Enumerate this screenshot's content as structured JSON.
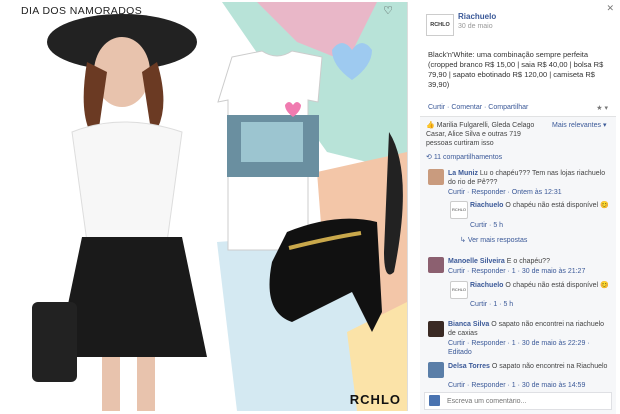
{
  "photo": {
    "title": "DIA DOS NAMORADOS",
    "brand": "RCHLO"
  },
  "post": {
    "page_name": "Riachuelo",
    "date": "30 de maio",
    "logo": "RCHLO",
    "caption": "Black'n'White: uma combinação sempre perfeita (cropped branco R$ 15,00 | saia R$ 40,00 | bolsa R$ 79,90 | sapato ebotinado R$ 120,00 | camiseta R$ 39,90)",
    "actions": "Curtir · Comentar · Compartilhar",
    "likes": "Marilia Fulgarelli, Gleda Celago Casar, Alice Silva e outras 719 pessoas curtiram isso",
    "sort": "Mais relevantes",
    "shares": "11 compartilhamentos"
  },
  "comments": [
    {
      "author": "La Muniz",
      "text": "Lu o chapéu??? Tem nas lojas riachuelo do rio de Pê???",
      "meta": "Curtir · Responder · Ontem às 12:31"
    },
    {
      "author": "Riachuelo",
      "text": "O chapéu não está disponível",
      "meta": "Curtir · 5 h"
    },
    {
      "author": "",
      "text": "Ver mais respostas",
      "meta": ""
    },
    {
      "author": "Manoelle Silveira",
      "text": "E o chapéu??",
      "meta": "Curtir · Responder · 1 · 30 de maio às 21:27"
    },
    {
      "author": "Riachuelo",
      "text": "O chapéu não está disponível",
      "meta": "Curtir · 1 · 5 h"
    },
    {
      "author": "Bianca Silva",
      "text": "O sapato não encontrei na riachuelo de caxias",
      "meta": "Curtir · Responder · 1 · 30 de maio às 22:29 · Editado"
    },
    {
      "author": "Delsa Torres",
      "text": "O sapato não encontrei na Riachuelo",
      "meta": "Curtir · Responder · 1 · 30 de maio às 14:59"
    }
  ],
  "composer": {
    "placeholder": "Escreva um comentário..."
  }
}
